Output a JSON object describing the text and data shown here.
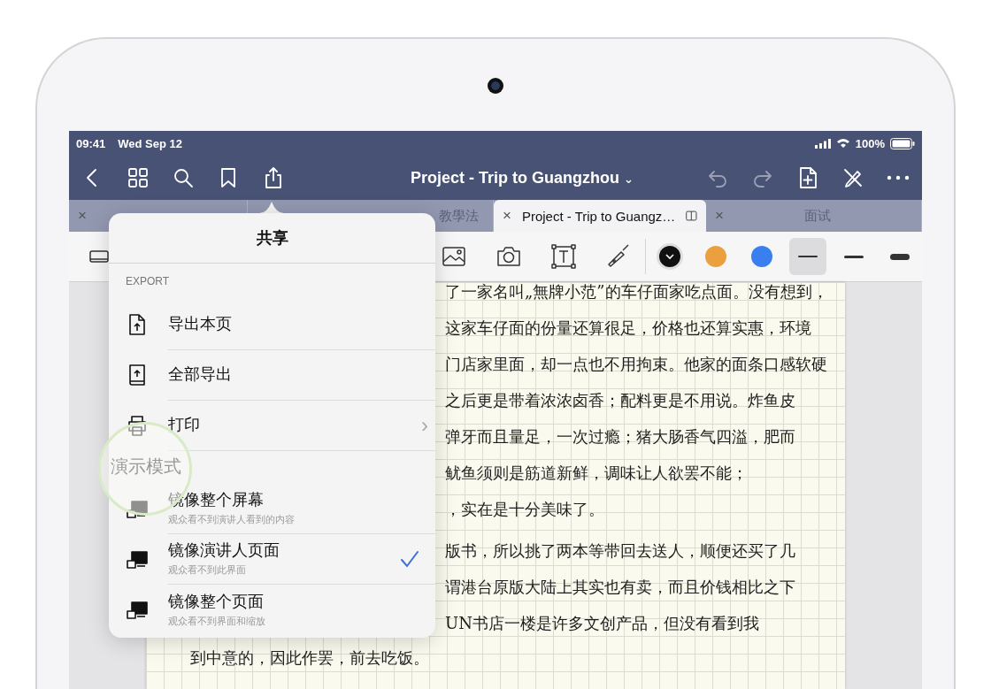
{
  "status_bar": {
    "time": "09:41",
    "date": "Wed Sep 12",
    "battery": "100%"
  },
  "nav_bar": {
    "title": "Project - Trip to Guangzhou",
    "caret": "⌄",
    "left_actions": [
      {
        "kind": "back"
      },
      {
        "kind": "grid"
      },
      {
        "kind": "search"
      },
      {
        "kind": "bookmark"
      },
      {
        "kind": "share"
      }
    ],
    "right_actions": [
      {
        "kind": "undo",
        "disabled": true
      },
      {
        "kind": "redo",
        "disabled": true
      },
      {
        "kind": "add-page",
        "disabled": false
      },
      {
        "kind": "pen-off",
        "disabled": false
      },
      {
        "kind": "more",
        "disabled": false
      }
    ]
  },
  "tabs": [
    {
      "close": "×",
      "selected": false
    },
    {
      "label": "教學法",
      "selected": false
    },
    {
      "close": "×",
      "label": "Project - Trip to Guangz…",
      "selected": true
    },
    {
      "close": "×",
      "label": "面试",
      "selected": false
    }
  ],
  "toolbar": {
    "tools": [
      {
        "kind": "eraser"
      },
      {
        "kind": "image"
      },
      {
        "kind": "camera"
      },
      {
        "kind": "text"
      },
      {
        "kind": "highlighter"
      }
    ],
    "colors": [
      {
        "color": "#111111",
        "selected": true
      },
      {
        "color": "#eba040",
        "selected": false
      },
      {
        "color": "#3a7ff0",
        "selected": false
      }
    ],
    "stroke_widths": [
      {
        "selected": true
      },
      {
        "selected": false
      },
      {
        "selected": false
      }
    ]
  },
  "note": {
    "lines": [
      "了一家名叫„無牌小范”的车仔面家吃点面。没有想到，",
      "这家车仔面的份量还算很足，价格也还算实惠，环境",
      "门店家里面，却一点也不用拘束。他家的面条口感软硬",
      "之后更是带着浓浓卤香；配料更是不用说。炸鱼皮",
      "弹牙而且量足，一次过瘾；猪大肠香气四溢，肥而",
      "鱿鱼须则是筋道新鲜，调味让人欲罢不能；",
      "，实在是十分美味了。",
      "版书，所以挑了两本等带回去送人，顺便还买了几",
      "谓港台原版大陆上其实也有卖，而且价钱相比之下",
      "UN书店一楼是许多文创产品，但没有看到我"
    ],
    "closing_line": "到中意的，因此作罢，前去吃饭。"
  },
  "share_popover": {
    "title": "共享",
    "sections": [
      {
        "header": "EXPORT",
        "highlighted": false,
        "items": [
          {
            "kind": "export-page",
            "label": "导出本页"
          },
          {
            "kind": "export-all",
            "label": "全部导出"
          },
          {
            "kind": "print",
            "label": "打印",
            "chevron": "›"
          }
        ]
      },
      {
        "header": "演示模式",
        "highlighted": true,
        "items": [
          {
            "kind": "mirror",
            "label": "镜像整个屏幕",
            "subtitle": "观众看不到演讲人看到的内容",
            "checked": false
          },
          {
            "kind": "mirror",
            "label": "镜像演讲人页面",
            "subtitle": "观众看不到此界面",
            "checked": true
          },
          {
            "kind": "mirror",
            "label": "镜像整个页面",
            "subtitle": "观众看不到界面和缩放",
            "checked": false
          }
        ]
      }
    ]
  }
}
